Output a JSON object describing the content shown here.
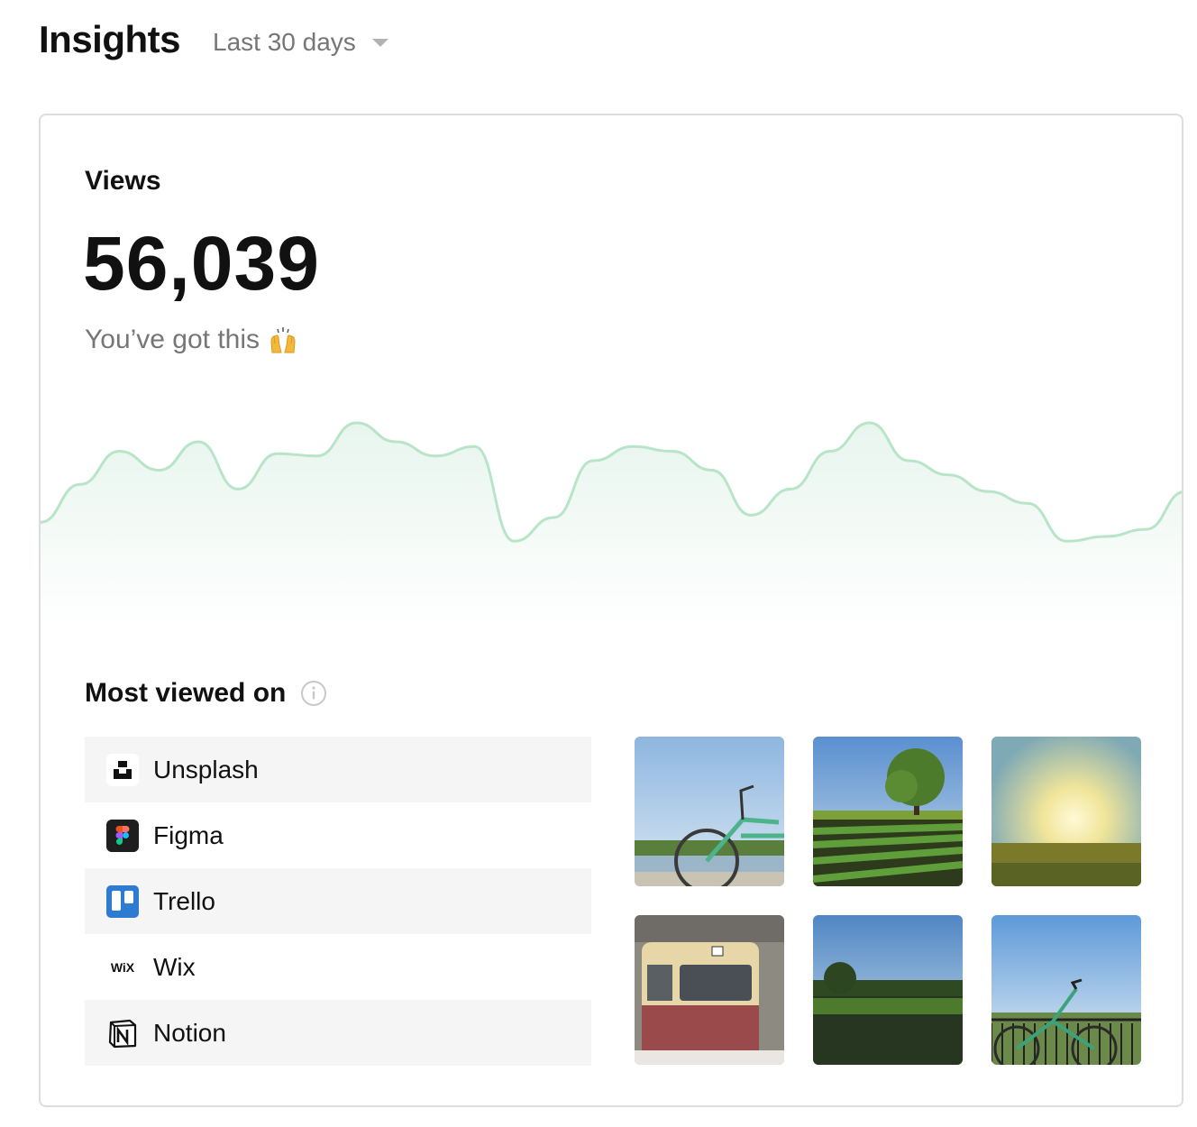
{
  "header": {
    "title": "Insights",
    "range": "Last 30 days"
  },
  "views": {
    "label": "Views",
    "count": "56,039",
    "subtitle": "You’ve got this"
  },
  "chart_data": {
    "type": "area",
    "x": [
      1,
      2,
      3,
      4,
      5,
      6,
      7,
      8,
      9,
      10,
      11,
      12,
      13,
      14,
      15,
      16,
      17,
      18,
      19,
      20,
      21,
      22,
      23,
      24,
      25,
      26,
      27,
      28,
      29,
      30
    ],
    "values": [
      300,
      460,
      600,
      520,
      640,
      440,
      590,
      580,
      720,
      640,
      580,
      620,
      220,
      320,
      560,
      620,
      600,
      520,
      330,
      440,
      600,
      720,
      560,
      500,
      430,
      380,
      220,
      240,
      270,
      430
    ],
    "line_color": "#b8e4c8",
    "fill_color": "#eef8f3",
    "grid": false,
    "legend": "none"
  },
  "most_viewed": {
    "title": "Most viewed on",
    "apps": [
      {
        "name": "Unsplash",
        "icon": "unsplash-icon"
      },
      {
        "name": "Figma",
        "icon": "figma-icon"
      },
      {
        "name": "Trello",
        "icon": "trello-icon"
      },
      {
        "name": "Wix",
        "icon": "wix-icon",
        "logo_text": "WiX"
      },
      {
        "name": "Notion",
        "icon": "notion-icon"
      }
    ],
    "photos": [
      "bicycle-by-lake-photo",
      "tree-and-crop-field-photo",
      "sunset-over-meadow-photo",
      "tram-photo",
      "green-field-photo",
      "bicycle-by-railing-photo"
    ]
  },
  "colors": {
    "muted_text": "#767676",
    "card_border": "#dddddd",
    "row_shade": "#f5f5f5",
    "trello_blue": "#2e7bd2"
  }
}
